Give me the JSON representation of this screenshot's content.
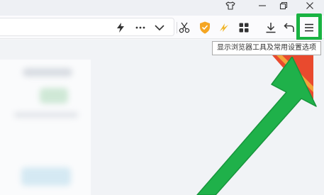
{
  "window": {
    "controls": [
      "tshirt-icon",
      "minimize-icon",
      "restore-icon",
      "close-icon"
    ]
  },
  "toolbar": {
    "icons": [
      "lightning-icon",
      "more-icon",
      "chevron-down-icon",
      "scissors-icon",
      "shield-icon",
      "speed-icon",
      "apps-icon",
      "download-icon",
      "undo-icon",
      "menu-icon"
    ],
    "highlight_color": "#19b342"
  },
  "tooltip": {
    "text": "显示浏览器工具及常用设置选项"
  },
  "colors": {
    "arrow": "#1fb14a",
    "badge": "#e94a2e"
  }
}
